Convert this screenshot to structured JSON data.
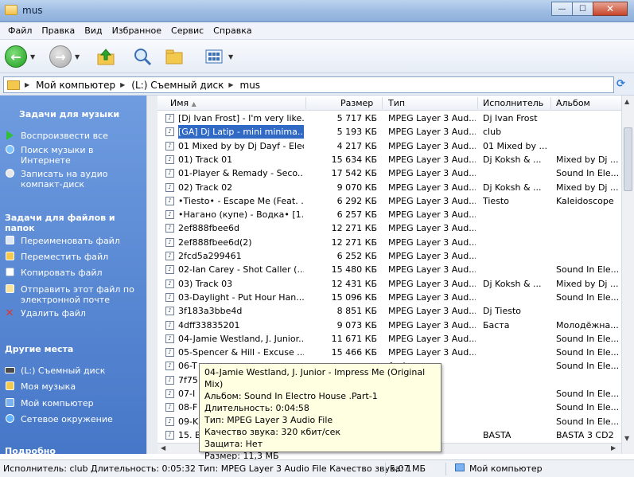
{
  "window": {
    "title": "mus"
  },
  "menu": [
    "Файл",
    "Правка",
    "Вид",
    "Избранное",
    "Сервис",
    "Справка"
  ],
  "address": {
    "crumbs": [
      "Мой компьютер",
      "(L:) Съемный диск",
      "mus"
    ]
  },
  "left_pane": {
    "sections": [
      {
        "title": "Задачи для музыки",
        "items": [
          "Воспроизвести все",
          "Поиск музыки в Интернете",
          "Записать на аудио компакт-диск"
        ]
      },
      {
        "title": "Задачи для файлов и папок",
        "items": [
          "Переименовать файл",
          "Переместить файл",
          "Копировать файл",
          "Отправить этот файл по электронной почте",
          "Удалить файл"
        ]
      },
      {
        "title": "Другие места",
        "items": [
          "(L:) Съемный диск",
          "Моя музыка",
          "Мой компьютер",
          "Сетевое окружение"
        ]
      },
      {
        "title": "Подробно",
        "items": []
      }
    ]
  },
  "columns": {
    "name": "Имя",
    "size": "Размер",
    "type": "Тип",
    "artist": "Исполнитель",
    "album": "Альбом"
  },
  "files": [
    {
      "name": "[Dj Ivan Frost] - I'm very like...",
      "size": "5 717 КБ",
      "type": "MPEG Layer 3 Aud...",
      "artist": "Dj Ivan Frost",
      "album": ""
    },
    {
      "name": "[GA] Dj Latip - mini minima...",
      "size": "5 193 КБ",
      "type": "MPEG Layer 3 Aud...",
      "artist": "club",
      "album": "",
      "selected": true
    },
    {
      "name": "01 Mixed by by Dj Dayf - Electr...",
      "size": "4 217 КБ",
      "type": "MPEG Layer 3 Aud...",
      "artist": "01 Mixed by ...",
      "album": ""
    },
    {
      "name": "01)  Track 01",
      "size": "15 634 КБ",
      "type": "MPEG Layer 3 Aud...",
      "artist": "Dj Koksh & ...",
      "album": "Mixed by Dj ..."
    },
    {
      "name": "01-Player & Remady - Seco...",
      "size": "17 542 КБ",
      "type": "MPEG Layer 3 Aud...",
      "artist": "",
      "album": "Sound In Ele..."
    },
    {
      "name": "02)  Track 02",
      "size": "9 070 КБ",
      "type": "MPEG Layer 3 Aud...",
      "artist": "Dj Koksh & ...",
      "album": "Mixed by Dj ..."
    },
    {
      "name": "•Tiesto• - Escape Me (Feat. ...",
      "size": "6 292 КБ",
      "type": "MPEG Layer 3 Aud...",
      "artist": "Tiesto",
      "album": "Kaleidoscope"
    },
    {
      "name": "•Нагано (купе) - Водка• [1...",
      "size": "6 257 КБ",
      "type": "MPEG Layer 3 Aud...",
      "artist": "",
      "album": ""
    },
    {
      "name": "2ef888fbee6d",
      "size": "12 271 КБ",
      "type": "MPEG Layer 3 Aud...",
      "artist": "",
      "album": ""
    },
    {
      "name": "2ef888fbee6d(2)",
      "size": "12 271 КБ",
      "type": "MPEG Layer 3 Aud...",
      "artist": "",
      "album": ""
    },
    {
      "name": "2fcd5a299461",
      "size": "6 252 КБ",
      "type": "MPEG Layer 3 Aud...",
      "artist": "",
      "album": ""
    },
    {
      "name": "02-Ian Carey - Shot Caller (...",
      "size": "15 480 КБ",
      "type": "MPEG Layer 3 Aud...",
      "artist": "",
      "album": "Sound In Ele..."
    },
    {
      "name": "03)  Track 03",
      "size": "12 431 КБ",
      "type": "MPEG Layer 3 Aud...",
      "artist": "Dj Koksh & ...",
      "album": "Mixed by Dj ..."
    },
    {
      "name": "03-Daylight - Put Hour Han...",
      "size": "15 096 КБ",
      "type": "MPEG Layer 3 Aud...",
      "artist": "",
      "album": "Sound In Ele..."
    },
    {
      "name": "3f183a3bbe4d",
      "size": "8 851 КБ",
      "type": "MPEG Layer 3 Aud...",
      "artist": "Dj Tiesto",
      "album": ""
    },
    {
      "name": "4dff33835201",
      "size": "9 073 КБ",
      "type": "MPEG Layer 3 Aud...",
      "artist": "Баста",
      "album": "Молодёжна..."
    },
    {
      "name": "04-Jamie Westland, J. Junior...",
      "size": "11 671 КБ",
      "type": "MPEG Layer 3 Aud...",
      "artist": "",
      "album": "Sound In Ele..."
    },
    {
      "name": "05-Spencer & Hill - Excuse ...",
      "size": "15 466 КБ",
      "type": "MPEG Layer 3 Aud...",
      "artist": "",
      "album": "Sound In Ele..."
    },
    {
      "name": "06-T",
      "size": "",
      "type": "Aud...",
      "artist": "",
      "album": "Sound In Ele..."
    },
    {
      "name": "7f75",
      "size": "",
      "type": "Aud...",
      "artist": "",
      "album": ""
    },
    {
      "name": "07-I",
      "size": "",
      "type": "Aud...",
      "artist": "",
      "album": "Sound In Ele..."
    },
    {
      "name": "08-F",
      "size": "",
      "type": "Aud...",
      "artist": "",
      "album": "Sound In Ele..."
    },
    {
      "name": "09-K",
      "size": "",
      "type": "Aud...",
      "artist": "",
      "album": "Sound In Ele..."
    },
    {
      "name": "15. B",
      "size": "",
      "type": "Aud...",
      "artist": "BASTA",
      "album": "BASTA 3 CD2"
    }
  ],
  "tooltip": {
    "title": "04-Jamie Westland, J. Junior - Impress Me (Original Mix)",
    "album": "Альбом: Sound In Electro House .Part-1",
    "duration": "Длительность: 0:04:58",
    "type": "Тип: MPEG Layer 3 Audio File",
    "quality": "Качество звука: 320 кбит/сек",
    "protection": "Защита: Нет",
    "size": "Размер: 11,3 МБ"
  },
  "status": {
    "info": "Исполнитель: club Длительность: 0:05:32 Тип: MPEG Layer 3 Audio File Качество звука: 1",
    "size": "5,07 МБ",
    "location": "Мой компьютер"
  }
}
